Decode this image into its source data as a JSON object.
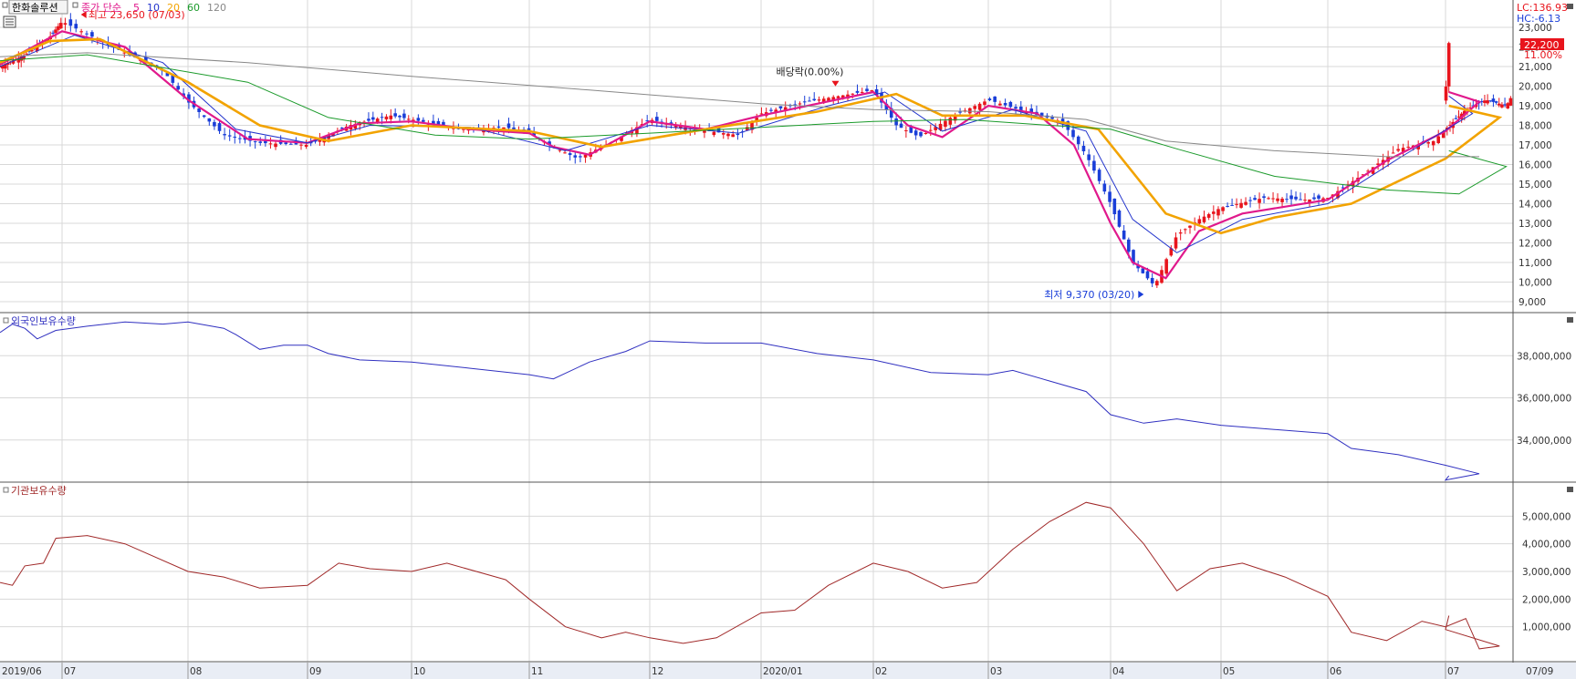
{
  "header": {
    "stock_name": "한화솔루션",
    "ma_label": "종가 단순",
    "ma_periods": [
      "5",
      "10",
      "20",
      "60",
      "120"
    ],
    "ma_colors": [
      "#e0198c",
      "#2233cc",
      "#f2a300",
      "#1a9a2a",
      "#888888"
    ],
    "high_note": "최고 23,650 (07/03)",
    "low_note": "최저 9,370 (03/20)",
    "dividend_note": "배당락(0.00%)",
    "lc": "LC:136.93",
    "hc": "HC:-6.13",
    "current_price": "22,200",
    "current_change": "11.00%"
  },
  "colors": {
    "up": "#e8141c",
    "down": "#1a3ed8",
    "foreign": "#3030c0",
    "inst": "#a02828",
    "grid": "#d8d8d8"
  },
  "chart_data": [
    {
      "type": "candlestick",
      "title": "",
      "x": [
        "2019/06",
        "07",
        "08",
        "09",
        "10",
        "11",
        "12",
        "2020/01",
        "02",
        "03",
        "04",
        "05",
        "06",
        "07",
        "07/09"
      ],
      "ylim": [
        9000,
        23000
      ],
      "ticks": [
        "9,000",
        "10,000",
        "11,000",
        "12,000",
        "13,000",
        "14,000",
        "15,000",
        "16,000",
        "17,000",
        "18,000",
        "19,000",
        "20,000",
        "21,000",
        "22,000",
        "23,000"
      ],
      "close_path": [
        [
          0,
          21000
        ],
        [
          0.4,
          21600
        ],
        [
          0.8,
          22500
        ],
        [
          1.0,
          23300
        ],
        [
          1.4,
          22000
        ],
        [
          1.8,
          20800
        ],
        [
          2.0,
          19200
        ],
        [
          2.3,
          17500
        ],
        [
          2.6,
          17100
        ],
        [
          3.0,
          17000
        ],
        [
          3.4,
          18000
        ],
        [
          3.8,
          18500
        ],
        [
          4.0,
          18300
        ],
        [
          4.4,
          17800
        ],
        [
          4.8,
          17900
        ],
        [
          5.0,
          17600
        ],
        [
          5.2,
          16900
        ],
        [
          5.4,
          16300
        ],
        [
          5.7,
          17200
        ],
        [
          6.0,
          18300
        ],
        [
          6.4,
          17800
        ],
        [
          6.8,
          17500
        ],
        [
          7.0,
          18600
        ],
        [
          7.4,
          19200
        ],
        [
          7.8,
          19600
        ],
        [
          8.0,
          19800
        ],
        [
          8.2,
          18000
        ],
        [
          8.4,
          17400
        ],
        [
          8.7,
          18500
        ],
        [
          9.0,
          19300
        ],
        [
          9.3,
          18700
        ],
        [
          9.6,
          18200
        ],
        [
          9.8,
          16500
        ],
        [
          10.0,
          14000
        ],
        [
          10.2,
          11000
        ],
        [
          10.4,
          9800
        ],
        [
          10.6,
          12400
        ],
        [
          10.8,
          13200
        ],
        [
          11.0,
          13800
        ],
        [
          11.4,
          14300
        ],
        [
          11.8,
          14200
        ],
        [
          12.0,
          14300
        ],
        [
          12.3,
          15500
        ],
        [
          12.6,
          16800
        ],
        [
          12.9,
          17200
        ],
        [
          13.0,
          17800
        ],
        [
          13.3,
          18800
        ],
        [
          13.6,
          19300
        ],
        [
          13.9,
          19000
        ],
        [
          14.0,
          19600
        ],
        [
          14.05,
          22200
        ]
      ],
      "ma_series": [
        {
          "name": "5",
          "path": [
            [
              0,
              21100
            ],
            [
              1.0,
              22800
            ],
            [
              1.5,
              22000
            ],
            [
              2.0,
              19300
            ],
            [
              2.5,
              17300
            ],
            [
              3.0,
              17100
            ],
            [
              3.5,
              18100
            ],
            [
              4.0,
              18200
            ],
            [
              4.5,
              17800
            ],
            [
              5.0,
              17600
            ],
            [
              5.2,
              16900
            ],
            [
              5.5,
              16500
            ],
            [
              6.0,
              18200
            ],
            [
              6.5,
              17800
            ],
            [
              7.0,
              18500
            ],
            [
              7.5,
              19100
            ],
            [
              8.0,
              19700
            ],
            [
              8.3,
              18000
            ],
            [
              8.6,
              17400
            ],
            [
              9.0,
              19000
            ],
            [
              9.4,
              18600
            ],
            [
              9.7,
              17000
            ],
            [
              10.0,
              13000
            ],
            [
              10.2,
              11000
            ],
            [
              10.5,
              10200
            ],
            [
              10.8,
              12600
            ],
            [
              11.2,
              13500
            ],
            [
              12.0,
              14200
            ],
            [
              12.5,
              16200
            ],
            [
              13.0,
              17700
            ],
            [
              13.5,
              19200
            ],
            [
              14.05,
              19700
            ]
          ]
        },
        {
          "name": "10",
          "path": [
            [
              0,
              21000
            ],
            [
              1.1,
              22600
            ],
            [
              1.8,
              21200
            ],
            [
              2.4,
              17800
            ],
            [
              3.0,
              17100
            ],
            [
              3.6,
              18000
            ],
            [
              4.5,
              17900
            ],
            [
              5.3,
              16700
            ],
            [
              6.0,
              18000
            ],
            [
              6.8,
              17600
            ],
            [
              7.6,
              19000
            ],
            [
              8.1,
              19700
            ],
            [
              8.6,
              17700
            ],
            [
              9.2,
              18800
            ],
            [
              9.8,
              17700
            ],
            [
              10.2,
              13200
            ],
            [
              10.6,
              11500
            ],
            [
              11.2,
              13200
            ],
            [
              12.0,
              14000
            ],
            [
              12.6,
              16300
            ],
            [
              13.4,
              18600
            ],
            [
              14.05,
              19500
            ]
          ]
        },
        {
          "name": "20",
          "path": [
            [
              0,
              21200
            ],
            [
              0.8,
              22300
            ],
            [
              1.3,
              22400
            ],
            [
              2.0,
              20200
            ],
            [
              2.6,
              18000
            ],
            [
              3.2,
              17200
            ],
            [
              4.0,
              18000
            ],
            [
              5.0,
              17700
            ],
            [
              5.6,
              16900
            ],
            [
              6.5,
              17800
            ],
            [
              7.5,
              18700
            ],
            [
              8.2,
              19600
            ],
            [
              8.6,
              18500
            ],
            [
              9.3,
              18500
            ],
            [
              9.9,
              17800
            ],
            [
              10.5,
              13500
            ],
            [
              11.0,
              12500
            ],
            [
              11.5,
              13300
            ],
            [
              12.2,
              14000
            ],
            [
              13.0,
              16300
            ],
            [
              13.8,
              18400
            ],
            [
              14.05,
              19000
            ]
          ]
        },
        {
          "name": "60",
          "path": [
            [
              0,
              21300
            ],
            [
              1.2,
              21600
            ],
            [
              2.5,
              20200
            ],
            [
              3.2,
              18400
            ],
            [
              4.2,
              17500
            ],
            [
              5.0,
              17300
            ],
            [
              6.0,
              17600
            ],
            [
              7.0,
              17900
            ],
            [
              8.0,
              18200
            ],
            [
              8.8,
              18300
            ],
            [
              9.5,
              18000
            ],
            [
              10.0,
              17800
            ],
            [
              10.6,
              16800
            ],
            [
              11.5,
              15400
            ],
            [
              12.5,
              14700
            ],
            [
              13.2,
              14500
            ],
            [
              13.9,
              15900
            ],
            [
              14.05,
              16700
            ]
          ]
        },
        {
          "name": "120",
          "path": [
            [
              0,
              21500
            ],
            [
              1.2,
              21700
            ],
            [
              2.5,
              21200
            ],
            [
              4.0,
              20500
            ],
            [
              5.5,
              19800
            ],
            [
              7.0,
              19100
            ],
            [
              8.0,
              18800
            ],
            [
              9.0,
              18700
            ],
            [
              9.8,
              18300
            ],
            [
              10.5,
              17200
            ],
            [
              11.5,
              16700
            ],
            [
              12.5,
              16400
            ],
            [
              13.5,
              16400
            ],
            [
              14.05,
              16400
            ]
          ]
        }
      ],
      "annotations": [
        {
          "text": "최고 23,650 (07/03)",
          "x": 1.15,
          "y": 23650
        },
        {
          "text": "최저 9,370 (03/20)",
          "x": 10.3,
          "y": 9370
        },
        {
          "text": "배당락(0.00%)",
          "x": 7.5,
          "y": 19200
        }
      ]
    },
    {
      "type": "line",
      "title": "외국인보유수량",
      "ylim": [
        32000000,
        40000000
      ],
      "ticks": [
        "34,000,000",
        "36,000,000",
        "38,000,000"
      ],
      "tick_values": [
        34000000,
        36000000,
        38000000
      ],
      "path": [
        [
          0,
          39100000
        ],
        [
          0.2,
          39500000
        ],
        [
          0.4,
          39300000
        ],
        [
          0.6,
          38800000
        ],
        [
          0.9,
          39200000
        ],
        [
          1.2,
          39400000
        ],
        [
          1.5,
          39600000
        ],
        [
          1.8,
          39500000
        ],
        [
          2.0,
          39600000
        ],
        [
          2.3,
          39300000
        ],
        [
          2.4,
          39000000
        ],
        [
          2.6,
          38300000
        ],
        [
          2.8,
          38500000
        ],
        [
          3.0,
          38500000
        ],
        [
          3.2,
          38100000
        ],
        [
          3.5,
          37800000
        ],
        [
          4.0,
          37700000
        ],
        [
          4.5,
          37400000
        ],
        [
          5.0,
          37100000
        ],
        [
          5.2,
          36900000
        ],
        [
          5.5,
          37700000
        ],
        [
          5.8,
          38200000
        ],
        [
          6.0,
          38700000
        ],
        [
          6.5,
          38600000
        ],
        [
          7.0,
          38600000
        ],
        [
          7.5,
          38100000
        ],
        [
          8.0,
          37800000
        ],
        [
          8.5,
          37200000
        ],
        [
          9.0,
          37100000
        ],
        [
          9.2,
          37300000
        ],
        [
          9.5,
          36800000
        ],
        [
          9.8,
          36300000
        ],
        [
          10.0,
          35200000
        ],
        [
          10.3,
          34800000
        ],
        [
          10.6,
          35000000
        ],
        [
          11.0,
          34700000
        ],
        [
          11.5,
          34500000
        ],
        [
          12.0,
          34300000
        ],
        [
          12.2,
          33600000
        ],
        [
          12.6,
          33300000
        ],
        [
          13.0,
          32800000
        ],
        [
          13.5,
          32400000
        ],
        [
          14.0,
          32100000
        ],
        [
          14.05,
          32300000
        ]
      ]
    },
    {
      "type": "line",
      "title": "기관보유수량",
      "ylim": [
        0,
        6000000
      ],
      "ticks": [
        "1,000,000",
        "2,000,000",
        "3,000,000",
        "4,000,000",
        "5,000,000"
      ],
      "tick_values": [
        1000000,
        2000000,
        3000000,
        4000000,
        5000000
      ],
      "path": [
        [
          0,
          2600000
        ],
        [
          0.2,
          2500000
        ],
        [
          0.4,
          3200000
        ],
        [
          0.7,
          3300000
        ],
        [
          0.9,
          4200000
        ],
        [
          1.2,
          4300000
        ],
        [
          1.5,
          4000000
        ],
        [
          2.0,
          3000000
        ],
        [
          2.3,
          2800000
        ],
        [
          2.6,
          2400000
        ],
        [
          3.0,
          2500000
        ],
        [
          3.3,
          3300000
        ],
        [
          3.6,
          3100000
        ],
        [
          4.0,
          3000000
        ],
        [
          4.3,
          3300000
        ],
        [
          4.8,
          2700000
        ],
        [
          5.0,
          2000000
        ],
        [
          5.3,
          1000000
        ],
        [
          5.6,
          600000
        ],
        [
          5.8,
          800000
        ],
        [
          6.0,
          600000
        ],
        [
          6.3,
          400000
        ],
        [
          6.6,
          600000
        ],
        [
          7.0,
          1500000
        ],
        [
          7.3,
          1600000
        ],
        [
          7.6,
          2500000
        ],
        [
          8.0,
          3300000
        ],
        [
          8.3,
          3000000
        ],
        [
          8.6,
          2400000
        ],
        [
          8.9,
          2600000
        ],
        [
          9.2,
          3800000
        ],
        [
          9.5,
          4800000
        ],
        [
          9.8,
          5500000
        ],
        [
          10.0,
          5300000
        ],
        [
          10.3,
          4000000
        ],
        [
          10.6,
          2300000
        ],
        [
          10.9,
          3100000
        ],
        [
          11.2,
          3300000
        ],
        [
          11.6,
          2800000
        ],
        [
          12.0,
          2100000
        ],
        [
          12.2,
          800000
        ],
        [
          12.5,
          500000
        ],
        [
          12.8,
          1200000
        ],
        [
          13.0,
          1000000
        ],
        [
          13.3,
          1300000
        ],
        [
          13.5,
          200000
        ],
        [
          13.8,
          300000
        ],
        [
          14.0,
          900000
        ],
        [
          14.05,
          1400000
        ]
      ]
    }
  ]
}
